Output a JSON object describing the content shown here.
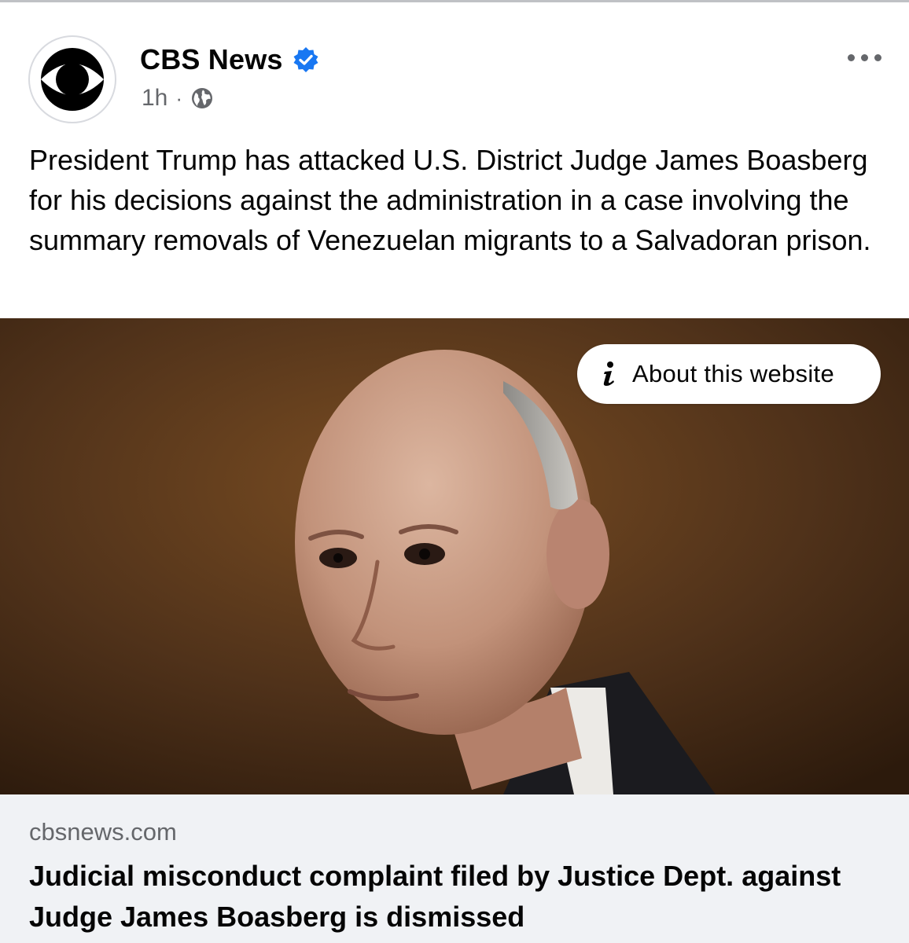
{
  "post": {
    "page_name": "CBS News",
    "verified_icon": "verified-badge-icon",
    "timestamp": "1h",
    "separator": "·",
    "audience_icon": "globe-icon",
    "more_icon": "more-options-icon",
    "caption": "President Trump has attacked U.S. District Judge James Boasberg for his decisions against the administration in a case involving the summary removals of Venezuelan migrants to a Salvadoran prison."
  },
  "image": {
    "about_label": "About this website",
    "about_icon": "info-icon"
  },
  "link_preview": {
    "domain": "cbsnews.com",
    "headline": "Judicial misconduct complaint filed by Justice Dept. against Judge James Boasberg is dismissed"
  },
  "colors": {
    "verified_blue": "#1877f2",
    "secondary_text": "#65676b",
    "preview_bg": "#f0f2f5"
  }
}
